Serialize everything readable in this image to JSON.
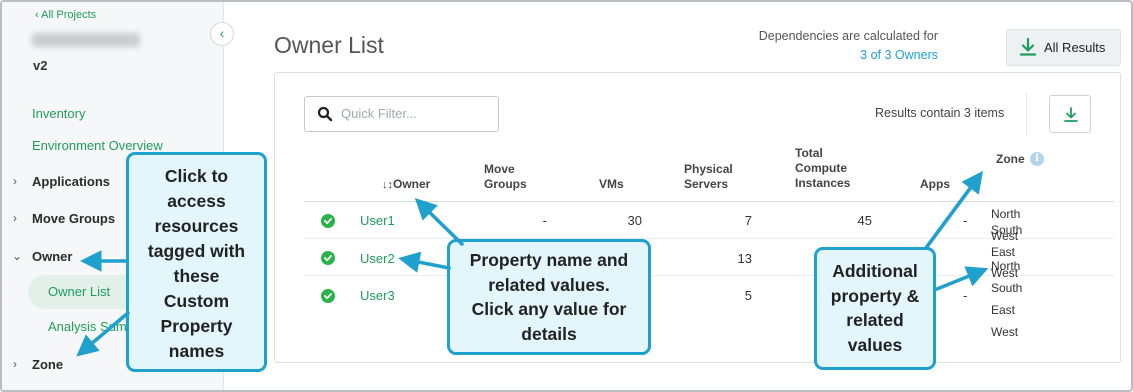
{
  "sidebar": {
    "back_link": "All Projects",
    "project_version": "v2",
    "links": {
      "inventory": "Inventory",
      "environment_overview": "Environment Overview"
    },
    "groups": {
      "applications": "Applications",
      "move_groups": "Move Groups",
      "owner": "Owner",
      "zone": "Zone"
    },
    "sub_items": {
      "owner_list": "Owner List",
      "analysis_summary": "Analysis Sum"
    }
  },
  "header": {
    "title": "Owner List",
    "dependencies_text": "Dependencies are calculated for",
    "dependencies_link": "3 of 3 Owners",
    "all_results_label": "All Results"
  },
  "toolbar": {
    "filter_placeholder": "Quick Filter...",
    "results_count": "Results contain 3 items"
  },
  "table": {
    "columns": {
      "owner": "Owner",
      "move_groups": [
        "Move",
        "Groups"
      ],
      "vms": "VMs",
      "physical_servers": [
        "Physical",
        "Servers"
      ],
      "total_compute": [
        "Total",
        "Compute",
        "Instances"
      ],
      "apps": "Apps",
      "zone": "Zone"
    },
    "rows": [
      {
        "owner": "User1",
        "move_groups": "-",
        "vms": "30",
        "physical_servers": "7",
        "total_compute": "45",
        "apps": "-"
      },
      {
        "owner": "User2",
        "move_groups": "",
        "vms": "",
        "physical_servers": "13",
        "total_compute": "",
        "apps": ""
      },
      {
        "owner": "User3",
        "move_groups": "",
        "vms": "",
        "physical_servers": "5",
        "total_compute": "",
        "apps": "-"
      }
    ],
    "zone_values": [
      "North",
      "South",
      "West",
      "East",
      "North",
      "West",
      "South",
      "East",
      "West"
    ]
  },
  "callouts": {
    "custom_property": [
      "Click to",
      "access",
      "resources",
      "tagged with",
      "these",
      "Custom",
      "Property",
      "names"
    ],
    "property_values": [
      "Property name and",
      "related values.",
      "Click any value for",
      "details"
    ],
    "additional": [
      "Additional",
      "property &",
      "related",
      "values"
    ]
  },
  "colors": {
    "accent_green": "#1f9d5b",
    "link_blue": "#1f9fd4",
    "callout_border": "#1fa0cd",
    "callout_fill": "#e3f6fc",
    "status_green": "#2bb24c"
  }
}
